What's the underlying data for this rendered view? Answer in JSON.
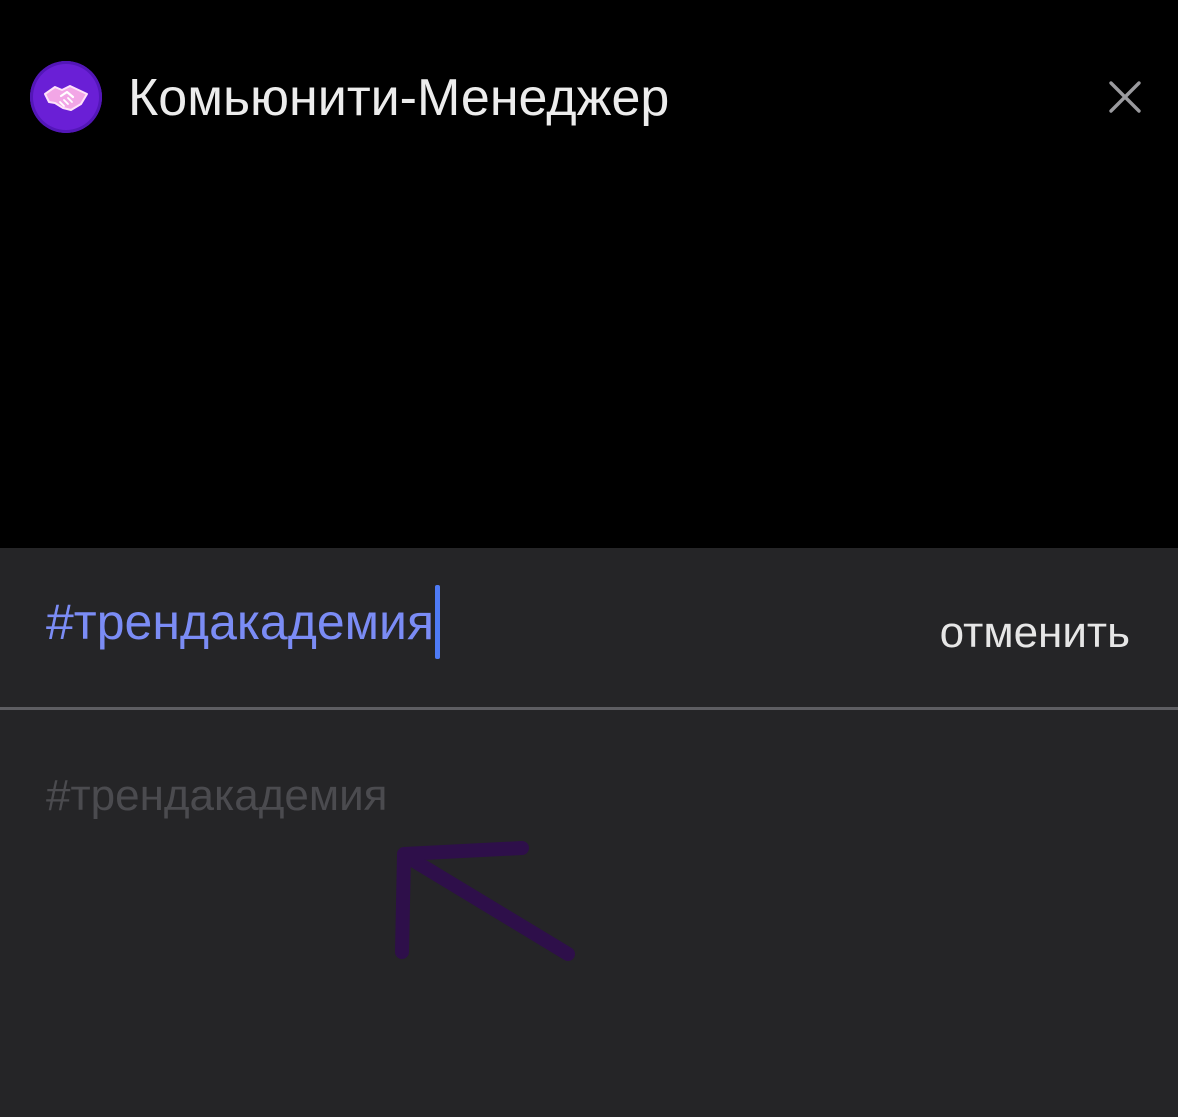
{
  "header": {
    "title": "Комьюнити-Менеджер",
    "avatar_icon": "handshake-icon",
    "close_icon": "close-icon"
  },
  "search": {
    "value": "#трендакадемия",
    "cancel_label": "отменить"
  },
  "suggestions": [
    {
      "label": "#трендакадемия"
    }
  ],
  "annotation": {
    "icon": "arrow-up-left-icon"
  },
  "colors": {
    "background": "#000000",
    "sheet": "#252527",
    "accent_text": "#7b8cf5",
    "caret": "#4e7bf6",
    "avatar": "#6a1fd6",
    "annotation_arrow": "#2e0f4a"
  }
}
